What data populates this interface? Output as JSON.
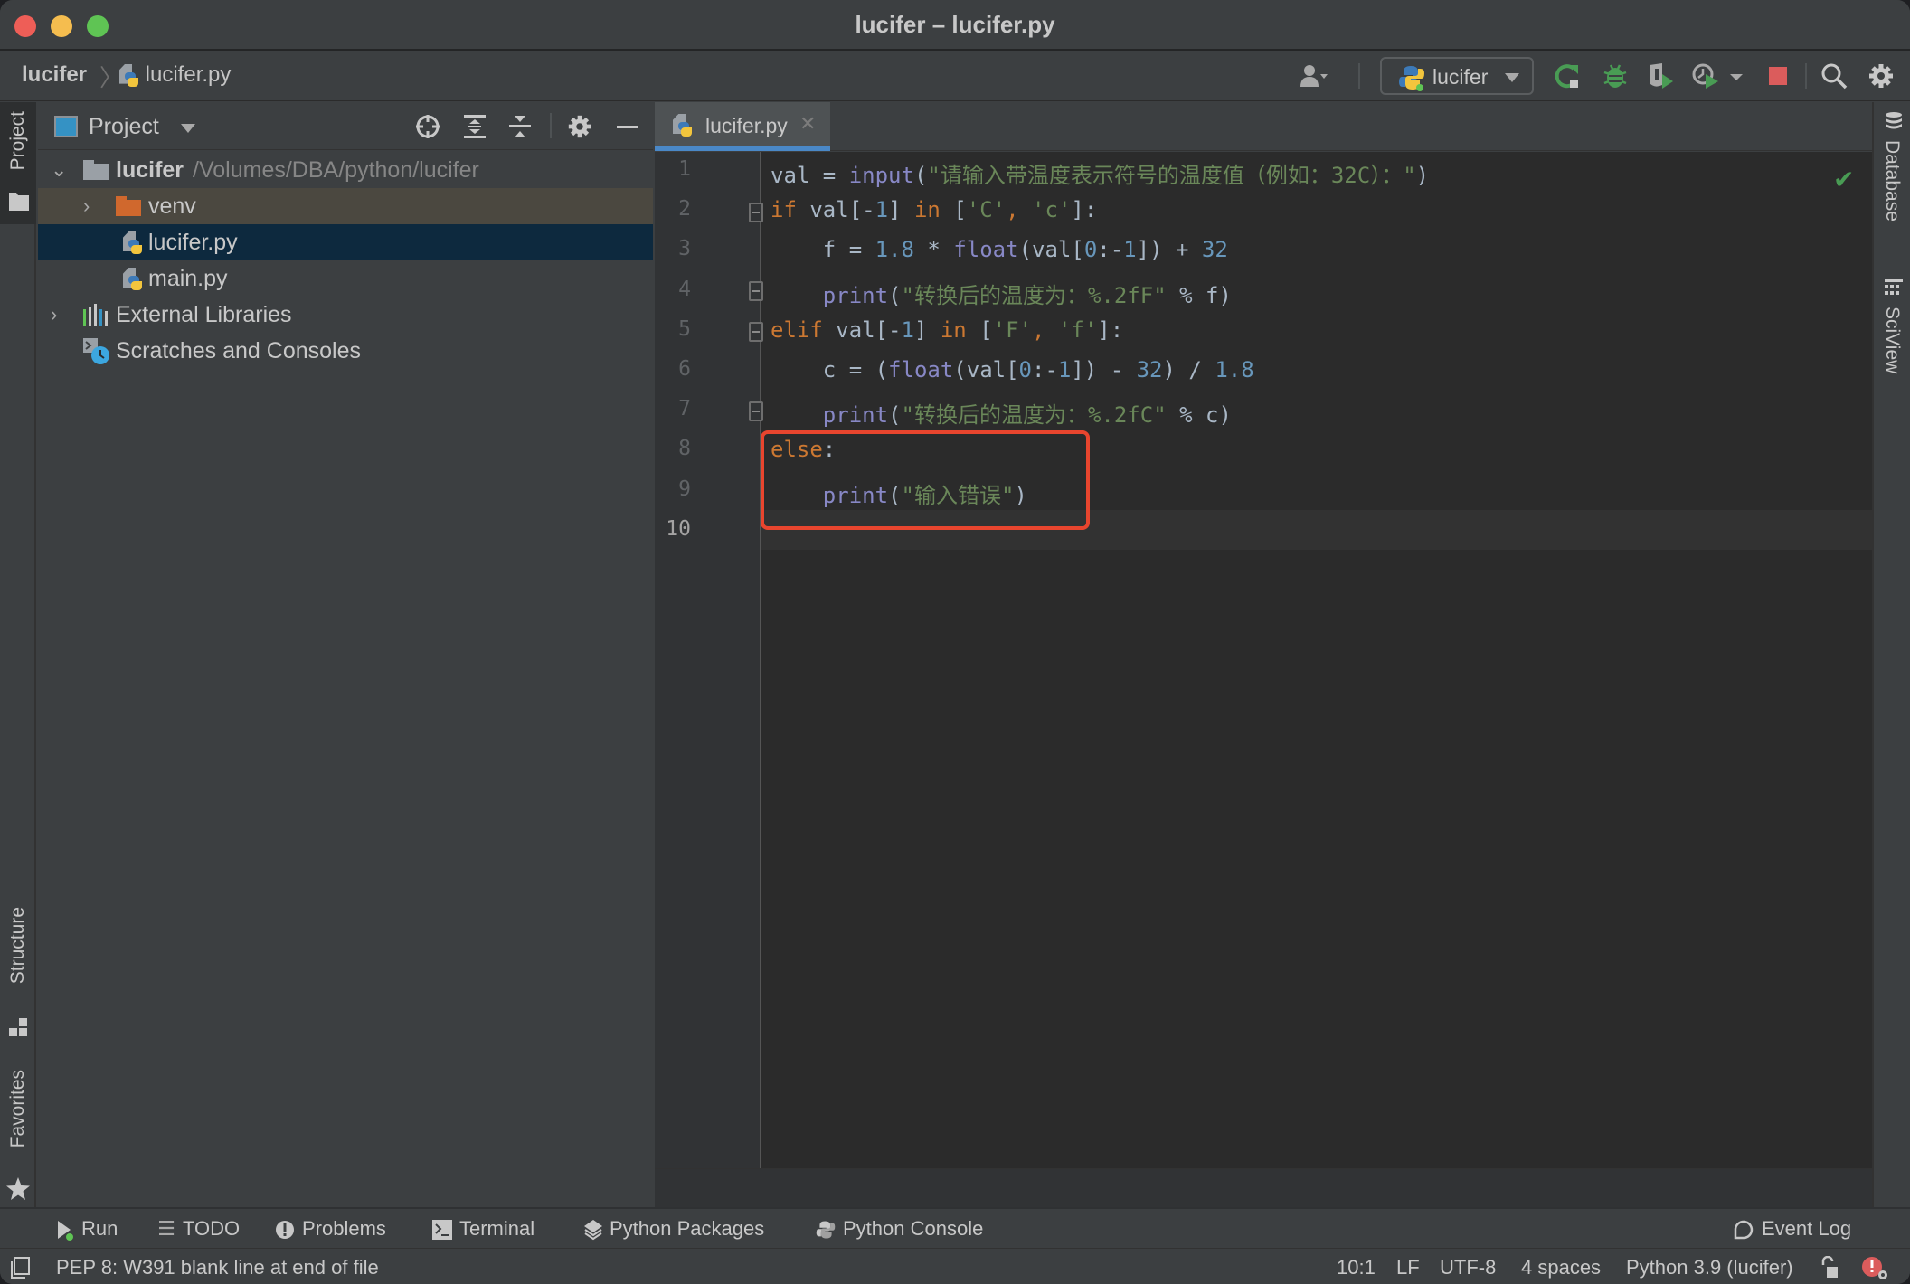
{
  "window": {
    "title": "lucifer – lucifer.py"
  },
  "navbar": {
    "breadcrumb": [
      {
        "label": "lucifer"
      },
      {
        "label": "lucifer.py",
        "icon": "python-file-icon"
      }
    ],
    "run_config": {
      "label": "lucifer",
      "icon": "python-logo-icon"
    },
    "actions": [
      {
        "name": "vcs-user-icon"
      },
      {
        "name": "rerun-icon",
        "color": "#499c54"
      },
      {
        "name": "debug-icon",
        "color": "#499c54"
      },
      {
        "name": "run-with-coverage-icon"
      },
      {
        "name": "profile-icon"
      },
      {
        "name": "stop-icon",
        "color": "#db5c5c"
      },
      {
        "name": "search-icon"
      },
      {
        "name": "settings-gear-icon"
      }
    ]
  },
  "left_strip": {
    "tabs": [
      {
        "label": "Project",
        "icon": "folder-icon"
      },
      {
        "label": "Structure",
        "icon": "structure-icon"
      },
      {
        "label": "Favorites",
        "icon": "star-icon"
      }
    ]
  },
  "project_panel": {
    "title": "Project",
    "tree": [
      {
        "label": "lucifer",
        "path": "/Volumes/DBA/python/lucifer",
        "type": "root-folder",
        "expanded": true
      },
      {
        "label": "venv",
        "type": "excluded-folder",
        "expanded": false
      },
      {
        "label": "lucifer.py",
        "type": "python-file",
        "selected": true
      },
      {
        "label": "main.py",
        "type": "python-file"
      },
      {
        "label": "External Libraries",
        "type": "libraries",
        "expanded": false
      },
      {
        "label": "Scratches and Consoles",
        "type": "scratches"
      }
    ]
  },
  "editor": {
    "tabs": [
      {
        "label": "lucifer.py",
        "active": true,
        "close_glyph": "✕"
      }
    ],
    "lines": [
      [
        {
          "t": "val = ",
          "c": ""
        },
        {
          "t": "input",
          "c": "bi"
        },
        {
          "t": "(",
          "c": ""
        },
        {
          "t": "\"请输入带温度表示符号的温度值（例如：32C）：\"",
          "c": "str"
        },
        {
          "t": ")",
          "c": ""
        }
      ],
      [
        {
          "t": "if",
          "c": "kw"
        },
        {
          "t": " val[-",
          "c": ""
        },
        {
          "t": "1",
          "c": "num"
        },
        {
          "t": "] ",
          "c": ""
        },
        {
          "t": "in",
          "c": "kw"
        },
        {
          "t": " [",
          "c": ""
        },
        {
          "t": "'C'",
          "c": "str"
        },
        {
          "t": ", ",
          "c": "kw"
        },
        {
          "t": "'c'",
          "c": "str"
        },
        {
          "t": "]:",
          "c": ""
        }
      ],
      [
        {
          "t": "    f = ",
          "c": ""
        },
        {
          "t": "1.8",
          "c": "num"
        },
        {
          "t": " * ",
          "c": ""
        },
        {
          "t": "float",
          "c": "bi"
        },
        {
          "t": "(val[",
          "c": ""
        },
        {
          "t": "0",
          "c": "num"
        },
        {
          "t": ":-",
          "c": ""
        },
        {
          "t": "1",
          "c": "num"
        },
        {
          "t": "]) + ",
          "c": ""
        },
        {
          "t": "32",
          "c": "num"
        }
      ],
      [
        {
          "t": "    ",
          "c": ""
        },
        {
          "t": "print",
          "c": "bi"
        },
        {
          "t": "(",
          "c": ""
        },
        {
          "t": "\"转换后的温度为：%.2fF\"",
          "c": "str"
        },
        {
          "t": " % f)",
          "c": ""
        }
      ],
      [
        {
          "t": "elif",
          "c": "kw"
        },
        {
          "t": " val[-",
          "c": ""
        },
        {
          "t": "1",
          "c": "num"
        },
        {
          "t": "] ",
          "c": ""
        },
        {
          "t": "in",
          "c": "kw"
        },
        {
          "t": " [",
          "c": ""
        },
        {
          "t": "'F'",
          "c": "str"
        },
        {
          "t": ", ",
          "c": "kw"
        },
        {
          "t": "'f'",
          "c": "str"
        },
        {
          "t": "]:",
          "c": ""
        }
      ],
      [
        {
          "t": "    c = (",
          "c": ""
        },
        {
          "t": "float",
          "c": "bi"
        },
        {
          "t": "(val[",
          "c": ""
        },
        {
          "t": "0",
          "c": "num"
        },
        {
          "t": ":-",
          "c": ""
        },
        {
          "t": "1",
          "c": "num"
        },
        {
          "t": "]) - ",
          "c": ""
        },
        {
          "t": "32",
          "c": "num"
        },
        {
          "t": ") / ",
          "c": ""
        },
        {
          "t": "1.8",
          "c": "num"
        }
      ],
      [
        {
          "t": "    ",
          "c": ""
        },
        {
          "t": "print",
          "c": "bi"
        },
        {
          "t": "(",
          "c": ""
        },
        {
          "t": "\"转换后的温度为：%.2fC\"",
          "c": "str"
        },
        {
          "t": " % c)",
          "c": ""
        }
      ],
      [
        {
          "t": "else",
          "c": "kw"
        },
        {
          "t": ":",
          "c": ""
        }
      ],
      [
        {
          "t": "    ",
          "c": ""
        },
        {
          "t": "print",
          "c": "bi"
        },
        {
          "t": "(",
          "c": ""
        },
        {
          "t": "\"输入错误\"",
          "c": "str"
        },
        {
          "t": ")",
          "c": ""
        }
      ],
      []
    ],
    "line_numbers": [
      "1",
      "2",
      "3",
      "4",
      "5",
      "6",
      "7",
      "8",
      "9",
      "10"
    ],
    "current_line": 10,
    "inspection_status": "ok",
    "annotation_highlight": {
      "lines": [
        8,
        9,
        10
      ],
      "color": "#e8452e"
    }
  },
  "right_strip": {
    "tabs": [
      {
        "label": "Database",
        "icon": "database-icon"
      },
      {
        "label": "SciView",
        "icon": "sciview-icon"
      }
    ]
  },
  "bottom_toolbar": {
    "left": [
      {
        "label": "Run",
        "icon": "run-icon"
      },
      {
        "label": "TODO",
        "icon": "todo-list-icon"
      },
      {
        "label": "Problems",
        "icon": "problems-icon"
      },
      {
        "label": "Terminal",
        "icon": "terminal-icon"
      },
      {
        "label": "Python Packages",
        "icon": "packages-icon"
      },
      {
        "label": "Python Console",
        "icon": "python-console-icon"
      }
    ],
    "right": [
      {
        "label": "Event Log",
        "icon": "event-log-icon"
      }
    ]
  },
  "status_bar": {
    "message": "PEP 8: W391 blank line at end of file",
    "position": "10:1",
    "line_separator": "LF",
    "encoding": "UTF-8",
    "indent": "4 spaces",
    "interpreter": "Python 3.9 (lucifer)"
  },
  "colors": {
    "accent": "#4a88c7",
    "selection": "#0d293e",
    "keyword": "#cc7832",
    "builtin": "#8888c6",
    "string": "#6a8759",
    "number": "#6897bb",
    "run_green": "#499c54",
    "stop_red": "#db5c5c"
  }
}
